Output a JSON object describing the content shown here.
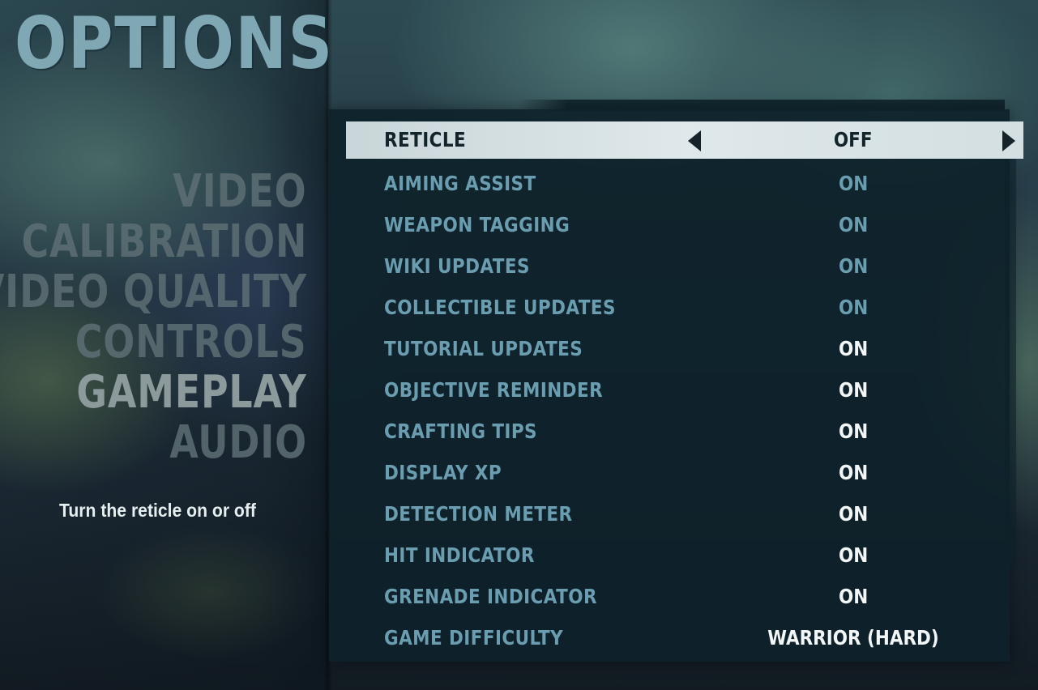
{
  "title": "OPTIONS",
  "nav": {
    "items": [
      {
        "label": "VIDEO",
        "active": false
      },
      {
        "label": "CALIBRATION",
        "active": false
      },
      {
        "label": "VIDEO QUALITY",
        "active": false
      },
      {
        "label": "CONTROLS",
        "active": false
      },
      {
        "label": "GAMEPLAY",
        "active": true
      },
      {
        "label": "AUDIO",
        "active": false
      }
    ]
  },
  "description": "Turn the reticle on or off",
  "settings": [
    {
      "label": "RETICLE",
      "value": "OFF"
    },
    {
      "label": "AIMING ASSIST",
      "value": "ON"
    },
    {
      "label": "WEAPON TAGGING",
      "value": "ON"
    },
    {
      "label": "WIKI UPDATES",
      "value": "ON"
    },
    {
      "label": "COLLECTIBLE UPDATES",
      "value": "ON"
    },
    {
      "label": "TUTORIAL UPDATES",
      "value": "ON"
    },
    {
      "label": "OBJECTIVE REMINDER",
      "value": "ON"
    },
    {
      "label": "CRAFTING TIPS",
      "value": "ON"
    },
    {
      "label": "DISPLAY XP",
      "value": "ON"
    },
    {
      "label": "DETECTION METER",
      "value": "ON"
    },
    {
      "label": "HIT INDICATOR",
      "value": "ON"
    },
    {
      "label": "GRENADE INDICATOR",
      "value": "ON"
    },
    {
      "label": "GAME DIFFICULTY",
      "value": "WARRIOR (HARD)"
    }
  ],
  "icons": {
    "prev": "arrow-left-icon",
    "next": "arrow-right-icon"
  }
}
